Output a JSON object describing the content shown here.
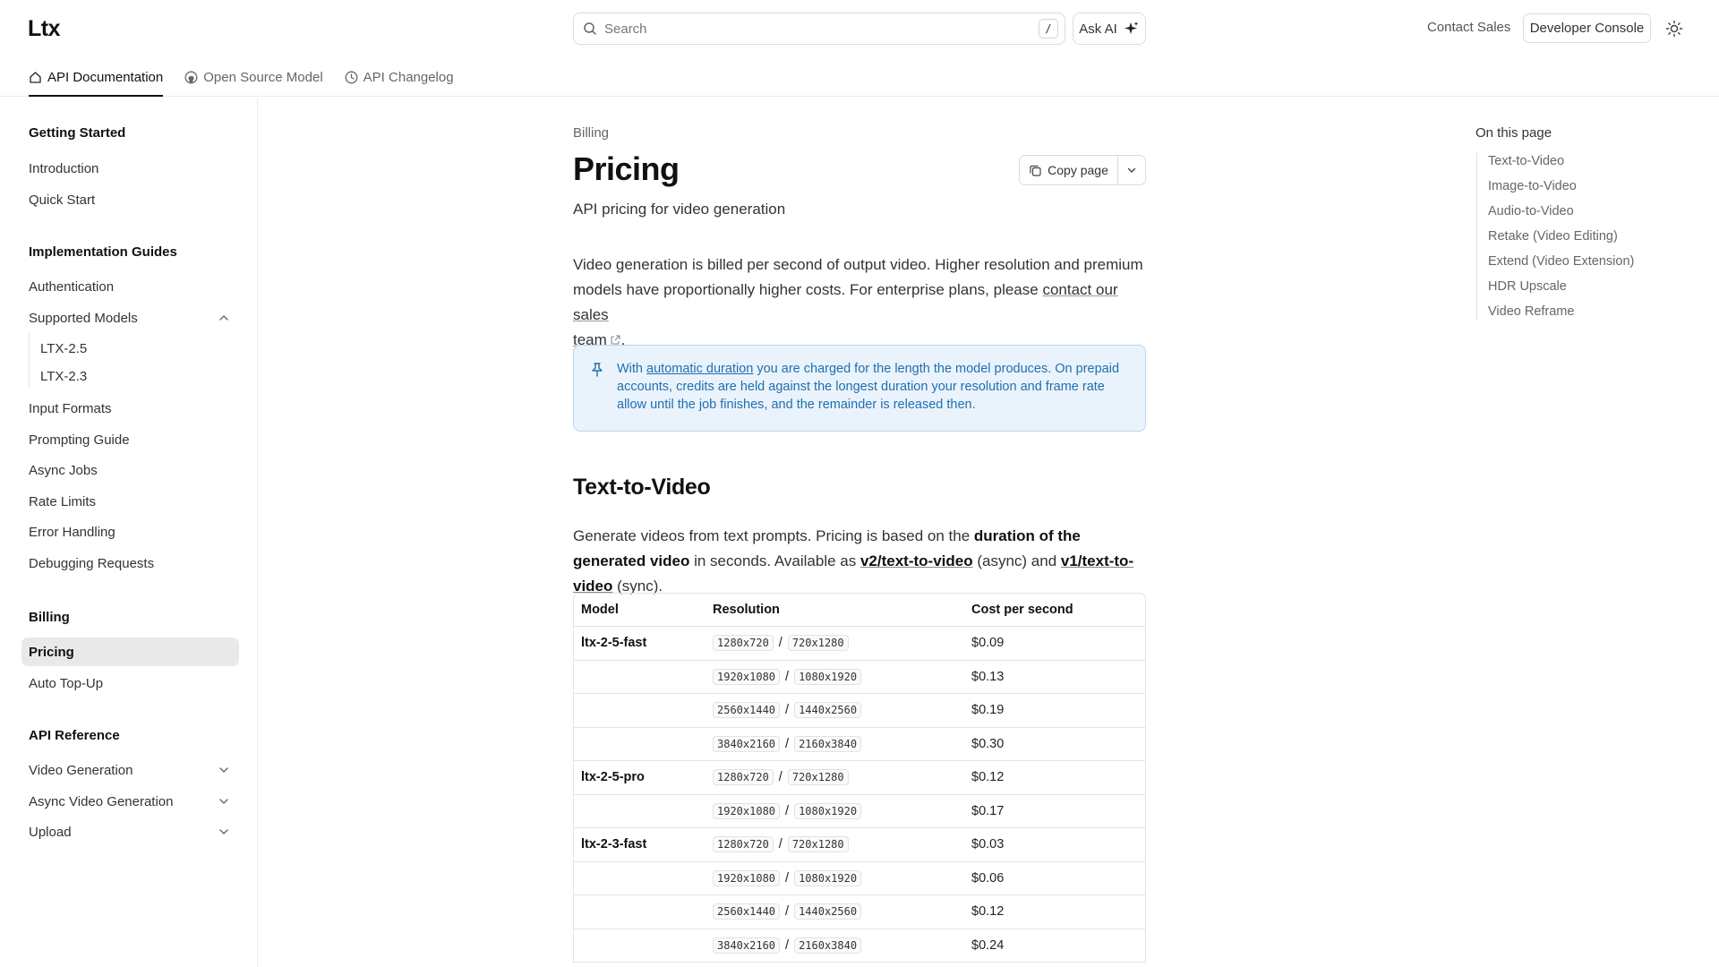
{
  "header": {
    "logo": "Ltx",
    "search_placeholder": "Search",
    "search_shortcut": "/",
    "ask_ai": "Ask AI",
    "contact_sales": "Contact Sales",
    "developer_console": "Developer Console"
  },
  "tabs": [
    {
      "label": "API Documentation",
      "icon": "home-icon",
      "active": true
    },
    {
      "label": "Open Source Model",
      "icon": "github-icon",
      "active": false
    },
    {
      "label": "API Changelog",
      "icon": "clock-icon",
      "active": false
    }
  ],
  "sidebar": {
    "getting_started": "Getting Started",
    "introduction": "Introduction",
    "quick_start": "Quick Start",
    "implementation_guides": "Implementation Guides",
    "authentication": "Authentication",
    "supported_models": "Supported Models",
    "ltx25": "LTX-2.5",
    "ltx23": "LTX-2.3",
    "input_formats": "Input Formats",
    "prompting_guide": "Prompting Guide",
    "async_jobs": "Async Jobs",
    "rate_limits": "Rate Limits",
    "error_handling": "Error Handling",
    "debugging_requests": "Debugging Requests",
    "billing": "Billing",
    "pricing": "Pricing",
    "auto_top_up": "Auto Top-Up",
    "api_reference": "API Reference",
    "video_generation": "Video Generation",
    "async_video_generation": "Async Video Generation",
    "upload": "Upload"
  },
  "main": {
    "breadcrumb": "Billing",
    "title": "Pricing",
    "copy_page": "Copy page",
    "description": "API pricing for video generation",
    "intro_text": "Video generation is billed per second of output video. Higher resolution and premium models have proportionally higher costs. For enterprise plans, please ",
    "intro_link_a": "contact our sales",
    "intro_link_b": "team",
    "intro_end": ".",
    "callout_pre": "With ",
    "callout_link": "automatic duration",
    "callout_text": " you are charged for the length the model produces. On prepaid accounts, credits are held against the longest duration your resolution and frame rate allow until the job finishes, and the remainder is released then.",
    "section_title": "Text-to-Video",
    "section_pre": "Generate videos from text prompts. Pricing is based on the ",
    "section_bold": "duration of the generated video",
    "section_mid": " in seconds. Available as ",
    "endpoint_async": "v2/text-to-video",
    "section_async": " (async) and ",
    "endpoint_sync": "v1/text-to-video",
    "section_end": " (sync).",
    "table": {
      "headers": [
        "Model",
        "Resolution",
        "Cost per second"
      ],
      "rows": [
        {
          "model": "ltx-2-5-fast",
          "res_a": "1280x720",
          "res_b": "720x1280",
          "cost": "$0.09"
        },
        {
          "model": "",
          "res_a": "1920x1080",
          "res_b": "1080x1920",
          "cost": "$0.13"
        },
        {
          "model": "",
          "res_a": "2560x1440",
          "res_b": "1440x2560",
          "cost": "$0.19"
        },
        {
          "model": "",
          "res_a": "3840x2160",
          "res_b": "2160x3840",
          "cost": "$0.30"
        },
        {
          "model": "ltx-2-5-pro",
          "res_a": "1280x720",
          "res_b": "720x1280",
          "cost": "$0.12"
        },
        {
          "model": "",
          "res_a": "1920x1080",
          "res_b": "1080x1920",
          "cost": "$0.17"
        },
        {
          "model": "ltx-2-3-fast",
          "res_a": "1280x720",
          "res_b": "720x1280",
          "cost": "$0.03"
        },
        {
          "model": "",
          "res_a": "1920x1080",
          "res_b": "1080x1920",
          "cost": "$0.06"
        },
        {
          "model": "",
          "res_a": "2560x1440",
          "res_b": "1440x2560",
          "cost": "$0.12"
        },
        {
          "model": "",
          "res_a": "3840x2160",
          "res_b": "2160x3840",
          "cost": "$0.24"
        }
      ]
    },
    "res_separator": "/"
  },
  "toc": {
    "title": "On this page",
    "items": [
      "Text-to-Video",
      "Image-to-Video",
      "Audio-to-Video",
      "Retake (Video Editing)",
      "Extend (Video Extension)",
      "HDR Upscale",
      "Video Reframe"
    ]
  },
  "colors": {
    "accent_blue": "#1f6fb0",
    "callout_bg": "#eaf3fb",
    "active_item_bg": "#e9e9e9"
  }
}
